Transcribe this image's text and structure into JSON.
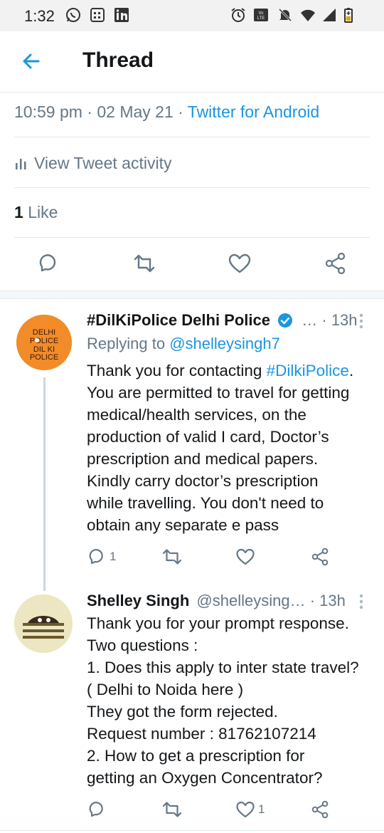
{
  "status_bar": {
    "time": "1:32",
    "icons": [
      "whatsapp-icon",
      "notes-app-icon",
      "linkedin-icon",
      "alarm-icon",
      "volte-icon",
      "mute-icon",
      "wifi-icon",
      "signal-icon",
      "battery-icon"
    ]
  },
  "header": {
    "back_icon": "arrow-left-icon",
    "title": "Thread"
  },
  "focused_tweet": {
    "time": "10:59 pm",
    "date": "02 May 21",
    "source": "Twitter for Android",
    "activity_label": "View Tweet activity",
    "like_count": "1",
    "like_label": "Like"
  },
  "tweets": [
    {
      "name": "#DilKiPolice Delhi Police",
      "verified": true,
      "handle": "…",
      "time": "13h",
      "replying_prefix": "Replying to",
      "replying_handle": "@shelleysingh7",
      "text_before_tag": "Thank you for contacting ",
      "hashtag": "#DilkiPolice",
      "text_after_tag": ".\nYou are permitted to travel for getting\nmedical/health services, on the\nproduction of valid I card, Doctor’s\nprescription and medical papers.\nKindly carry doctor’s prescription\nwhile travelling. You don't need to\nobtain any separate e pass",
      "avatar_text": [
        "DELHI",
        "POLICE",
        "DIL KI",
        "POLICE"
      ],
      "reply_count": "1",
      "retweet_count": "",
      "like_count": ""
    },
    {
      "name": "Shelley Singh",
      "handle": "@shelleysing…",
      "time": "13h",
      "text": "Thank you for your prompt response.\nTwo questions :\n1. Does this apply to inter state travel?\n( Delhi to Noida here )\nThey got the form rejected.\nRequest number : 81762107214\n2. How to get a prescription for\ngetting an Oxygen Concentrator?",
      "reply_count": "",
      "retweet_count": "",
      "like_count": "1"
    }
  ],
  "colors": {
    "accent": "#1b95e0",
    "secondary_text": "#657786",
    "police_orange": "#f28c28"
  }
}
